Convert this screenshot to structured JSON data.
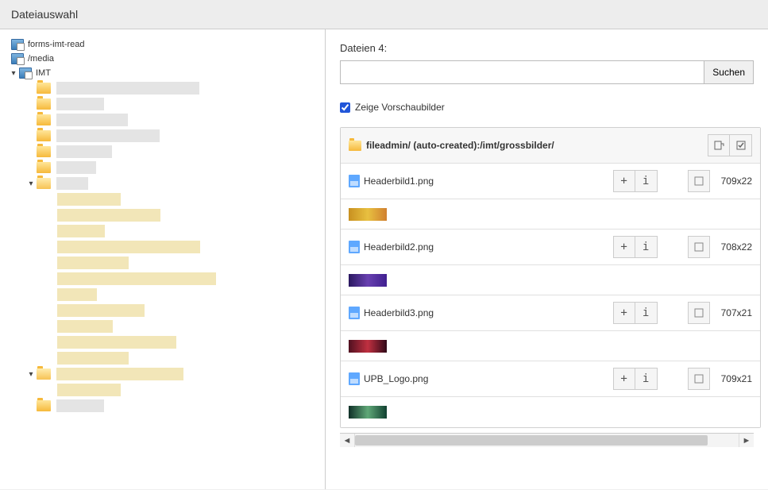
{
  "window": {
    "title": "Dateiauswahl"
  },
  "tree": {
    "storages": [
      {
        "label": "forms-imt-read"
      },
      {
        "label": "/media"
      },
      {
        "label": "IMT",
        "expanded": true
      }
    ]
  },
  "content": {
    "count_label": "Dateien 4:",
    "search_button": "Suchen",
    "search_placeholder": "",
    "thumbnails_label": "Zeige Vorschaubilder",
    "thumbnails_checked": true,
    "path_label": "fileadmin/ (auto-created):/imt/grossbilder/",
    "files": [
      {
        "name": "Headerbild1.png",
        "dim": "709x22"
      },
      {
        "name": "Headerbild2.png",
        "dim": "708x22"
      },
      {
        "name": "Headerbild3.png",
        "dim": "707x21"
      },
      {
        "name": "UPB_Logo.png",
        "dim": "709x21"
      }
    ],
    "thumb_colors": [
      "linear-gradient(90deg,#c89020,#e8c040,#d08030)",
      "linear-gradient(90deg,#2a1860,#6840b0,#402090)",
      "linear-gradient(90deg,#501020,#c03040,#300818)",
      "linear-gradient(90deg,#103028,#60a878,#104030)"
    ]
  }
}
